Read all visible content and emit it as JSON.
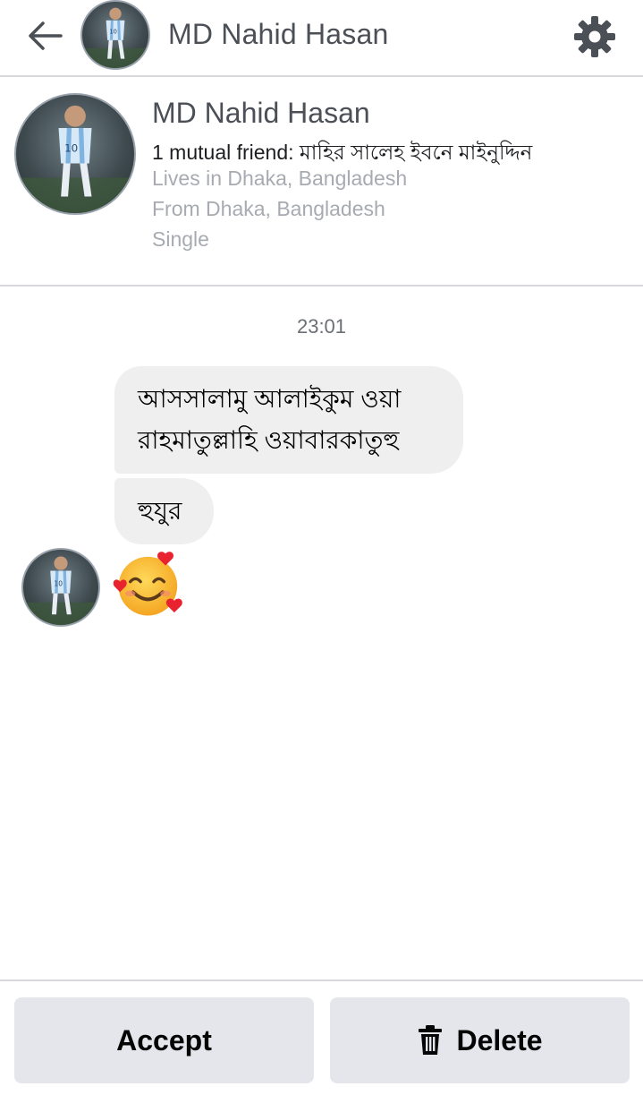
{
  "header": {
    "back_icon": "arrow-left-icon",
    "title": "MD Nahid Hasan",
    "settings_icon": "gear-icon"
  },
  "profile": {
    "name": "MD Nahid Hasan",
    "mutual": "1 mutual friend: মাহির সালেহ ইবনে মাইনুদ্দিন",
    "lives_in": "Lives in Dhaka, Bangladesh",
    "from": "From Dhaka, Bangladesh",
    "relationship": "Single"
  },
  "conversation": {
    "timestamp": "23:01",
    "messages": [
      {
        "text_line1": "আসসালামু আলাইকুম ওয়া",
        "text_line2": "রাহমাতুল্লাহি ওয়াবারকাতুহু"
      },
      {
        "text": "হুযুর"
      },
      {
        "emoji": "🥰"
      }
    ]
  },
  "actions": {
    "accept_label": "Accept",
    "delete_label": "Delete",
    "delete_icon": "trash-icon"
  },
  "colors": {
    "divider": "#d6d8dc",
    "bubble": "#efefef",
    "button": "#e4e6eb",
    "secondary_text": "#a7abb1"
  }
}
